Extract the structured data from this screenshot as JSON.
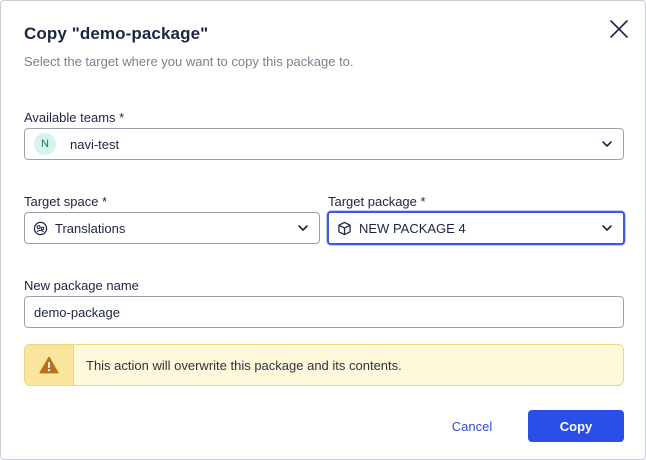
{
  "dialog": {
    "title": "Copy \"demo-package\"",
    "subtitle": "Select the target where you want to copy this package to."
  },
  "available_teams": {
    "label": "Available teams *",
    "selected": "navi-test",
    "avatar_letter": "N",
    "avatar_color": "#d3f3ee"
  },
  "target_space": {
    "label": "Target space *",
    "selected": "Translations",
    "icon": "space-icon"
  },
  "target_package": {
    "label": "Target package *",
    "selected": "NEW PACKAGE 4",
    "icon": "package-icon"
  },
  "new_package_name": {
    "label": "New package name",
    "value": "demo-package"
  },
  "warning": {
    "message": "This action will overwrite this package and its contents.",
    "icon": "warning-icon"
  },
  "buttons": {
    "cancel": "Cancel",
    "copy": "Copy"
  },
  "colors": {
    "accent": "#2b4de8",
    "focus_border": "#3d5ad8",
    "warning_bg": "#fdf8d9",
    "warning_icon": "#b9701a"
  }
}
